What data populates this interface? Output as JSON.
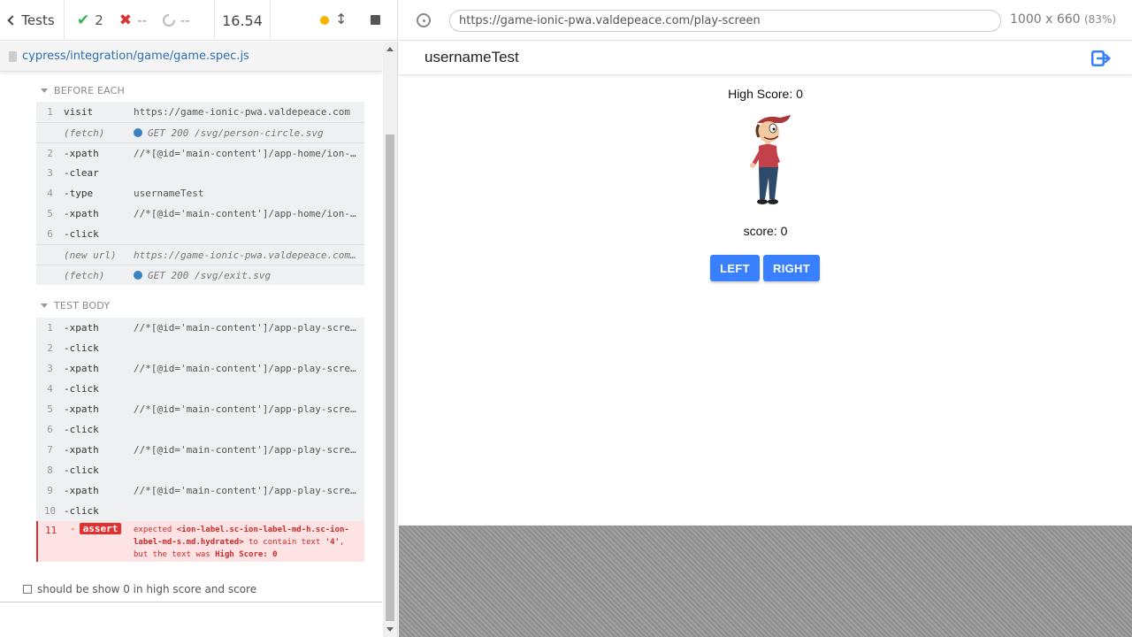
{
  "runner": {
    "tests_label": "Tests",
    "passed": "2",
    "failed": "--",
    "pending": "--",
    "duration": "16.54",
    "spec_path": "cypress/integration/game/game.spec.js"
  },
  "before_each": {
    "header": "BEFORE EACH",
    "rows": [
      {
        "n": "1",
        "cmd": "visit",
        "msg": "https://game-ionic-pwa.valdepeace.com"
      },
      {
        "n": "",
        "cmd": "(fetch)",
        "msg": "GET 200 /svg/person-circle.svg"
      },
      {
        "n": "2",
        "cmd": "-xpath",
        "msg": "//*[@id='main-content']/app-home/ion-…"
      },
      {
        "n": "3",
        "cmd": "-clear",
        "msg": ""
      },
      {
        "n": "4",
        "cmd": "-type",
        "msg": "usernameTest"
      },
      {
        "n": "5",
        "cmd": "-xpath",
        "msg": "//*[@id='main-content']/app-home/ion-…"
      },
      {
        "n": "6",
        "cmd": "-click",
        "msg": ""
      },
      {
        "n": "",
        "cmd": "(new url)",
        "msg": "https://game-ionic-pwa.valdepeace.com…"
      },
      {
        "n": "",
        "cmd": "(fetch)",
        "msg": "GET 200 /svg/exit.svg"
      }
    ]
  },
  "test_body": {
    "header": "TEST BODY",
    "rows": [
      {
        "n": "1",
        "cmd": "-xpath",
        "msg": "//*[@id='main-content']/app-play-scre…"
      },
      {
        "n": "2",
        "cmd": "-click",
        "msg": ""
      },
      {
        "n": "3",
        "cmd": "-xpath",
        "msg": "//*[@id='main-content']/app-play-scre…"
      },
      {
        "n": "4",
        "cmd": "-click",
        "msg": ""
      },
      {
        "n": "5",
        "cmd": "-xpath",
        "msg": "//*[@id='main-content']/app-play-scre…"
      },
      {
        "n": "6",
        "cmd": "-click",
        "msg": ""
      },
      {
        "n": "7",
        "cmd": "-xpath",
        "msg": "//*[@id='main-content']/app-play-scre…"
      },
      {
        "n": "8",
        "cmd": "-click",
        "msg": ""
      },
      {
        "n": "9",
        "cmd": "-xpath",
        "msg": "//*[@id='main-content']/app-play-scre…"
      },
      {
        "n": "10",
        "cmd": "-click",
        "msg": ""
      }
    ],
    "fail": {
      "n": "11",
      "dash": "-",
      "cmd": "assert",
      "msg_expected": "expected",
      "msg_selector": "<ion-label.sc-ion-label-md-h.sc-ion-label-md-s.md.hydrated>",
      "msg_mid": "to contain text",
      "msg_value": "'4'",
      "msg_but": ", but the text was",
      "msg_actual": "High Score: 0"
    }
  },
  "test_title": "should be show 0 in high score and score",
  "browser": {
    "url": "https://game-ionic-pwa.valdepeace.com/play-screen",
    "viewport": "1000 x 660",
    "zoom": "(83%)"
  },
  "app": {
    "username": "usernameTest",
    "high_score": "High Score: 0",
    "score": "score: 0",
    "left_label": "LEFT",
    "right_label": "RIGHT",
    "accent": "#3880ff"
  }
}
